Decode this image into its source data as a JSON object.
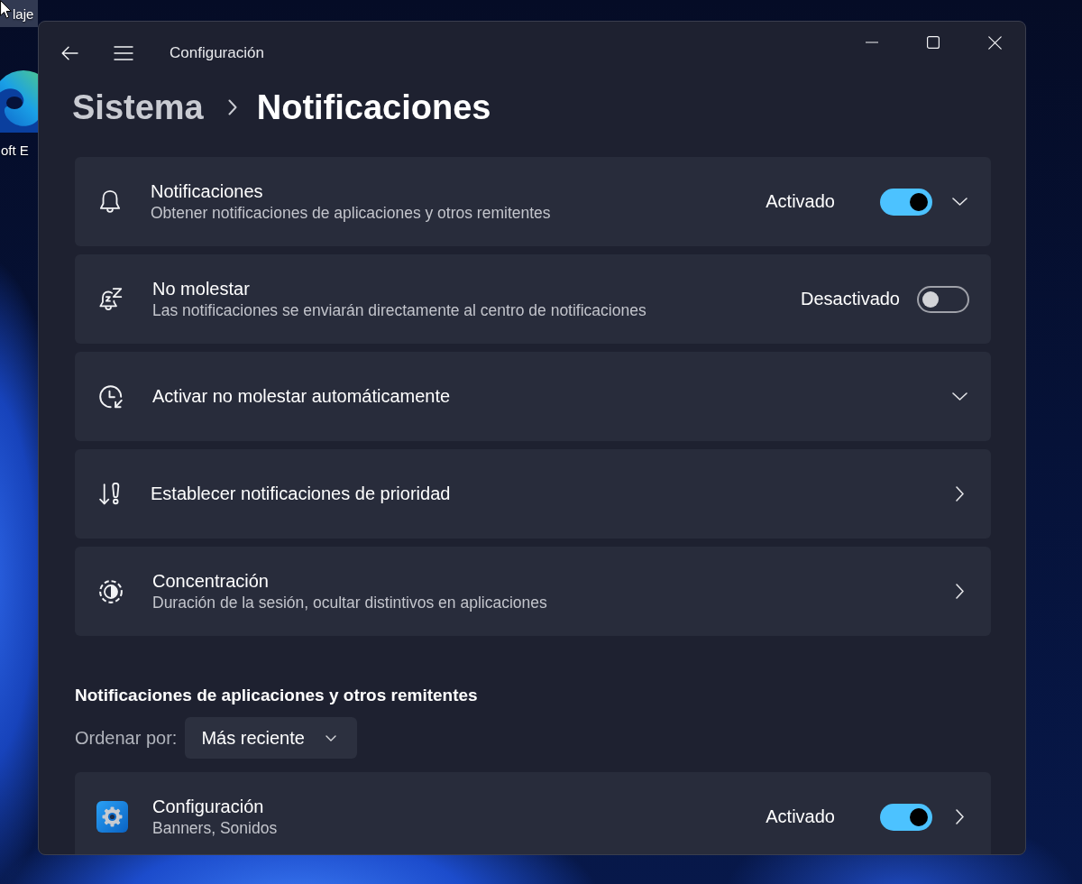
{
  "desktop": {
    "icons": [
      {
        "label": "laje",
        "selected": true
      },
      {
        "label": "oft E",
        "selected": false
      }
    ]
  },
  "window": {
    "title": "Configuración"
  },
  "breadcrumb": {
    "parent": "Sistema",
    "current": "Notificaciones"
  },
  "settings": [
    {
      "kind": "expander",
      "title": "Notificaciones",
      "description": "Obtener notificaciones de aplicaciones y otros remitentes",
      "toggle": {
        "label": "Activado",
        "on": true
      },
      "expanded": false
    },
    {
      "kind": "toggle",
      "title": "No molestar",
      "description": "Las notificaciones se enviarán directamente al centro de notificaciones",
      "toggle": {
        "label": "Desactivado",
        "on": false
      }
    },
    {
      "kind": "expander",
      "title": "Activar no molestar automáticamente",
      "expanded": false
    },
    {
      "kind": "link",
      "title": "Establecer notificaciones de prioridad"
    },
    {
      "kind": "link",
      "title": "Concentración",
      "description": "Duración de la sesión, ocultar distintivos en aplicaciones"
    }
  ],
  "app_notifications": {
    "title": "Notificaciones de aplicaciones y otros remitentes",
    "sort": {
      "label": "Ordenar por:",
      "value": "Más reciente"
    },
    "apps": [
      {
        "kind": "link",
        "name": "Configuración",
        "description": "Banners, Sonidos",
        "toggle": {
          "label": "Activado",
          "on": true
        }
      }
    ]
  }
}
